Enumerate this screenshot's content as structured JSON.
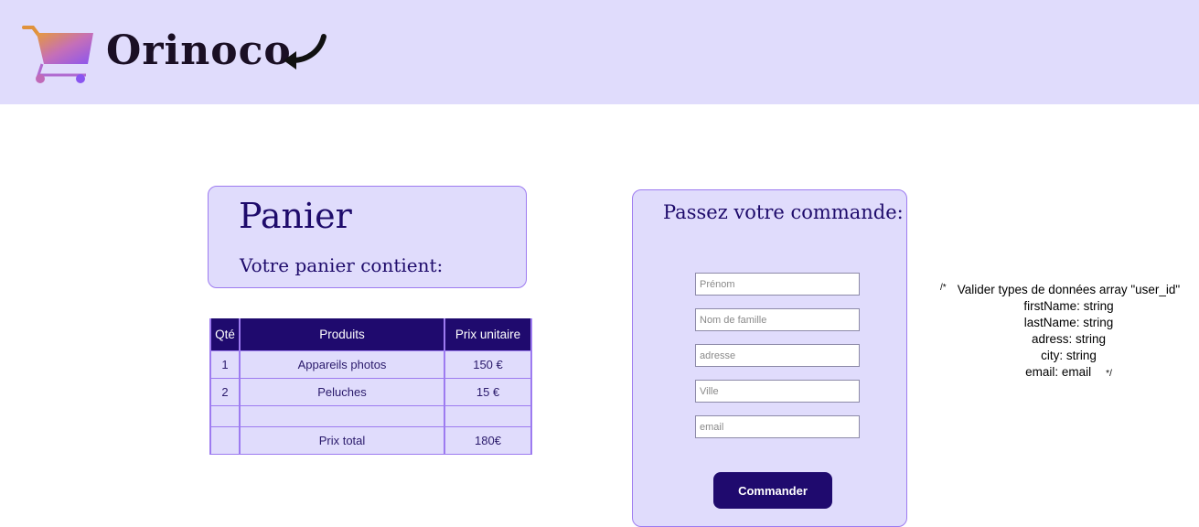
{
  "header": {
    "brand": "Orinoco",
    "cart_icon": "shopping-cart-icon",
    "arrow_icon": "curved-back-arrow-icon"
  },
  "panier": {
    "title": "Panier",
    "subtitle": "Votre panier contient:"
  },
  "cart_table": {
    "headers": [
      "Qté",
      "Produits",
      "Prix unitaire"
    ],
    "rows": [
      [
        "1",
        "Appareils photos",
        "150 €"
      ],
      [
        "2",
        "Peluches",
        "15 €"
      ],
      [
        "",
        "",
        ""
      ]
    ],
    "total_label": "Prix total",
    "total_value": "180€"
  },
  "order_form": {
    "title": "Passez votre commande:",
    "fields": {
      "firstname_placeholder": "Prénom",
      "lastname_placeholder": "Nom de famille",
      "address_placeholder": "adresse",
      "city_placeholder": "Ville",
      "email_placeholder": "email"
    },
    "submit_label": "Commander"
  },
  "comment": {
    "open": "/*",
    "line1": "Valider types de données array \"user_id\"",
    "line2": "firstName: string",
    "line3": "lastName: string",
    "line4": "adress: string",
    "line5": "city: string",
    "line6": "email: email",
    "close": "*/"
  },
  "colors": {
    "header_bg": "#e0dcfc",
    "accent_dark": "#1f0a6e",
    "border_purple": "#9d7bf0",
    "title_text": "#1e0b6b"
  }
}
